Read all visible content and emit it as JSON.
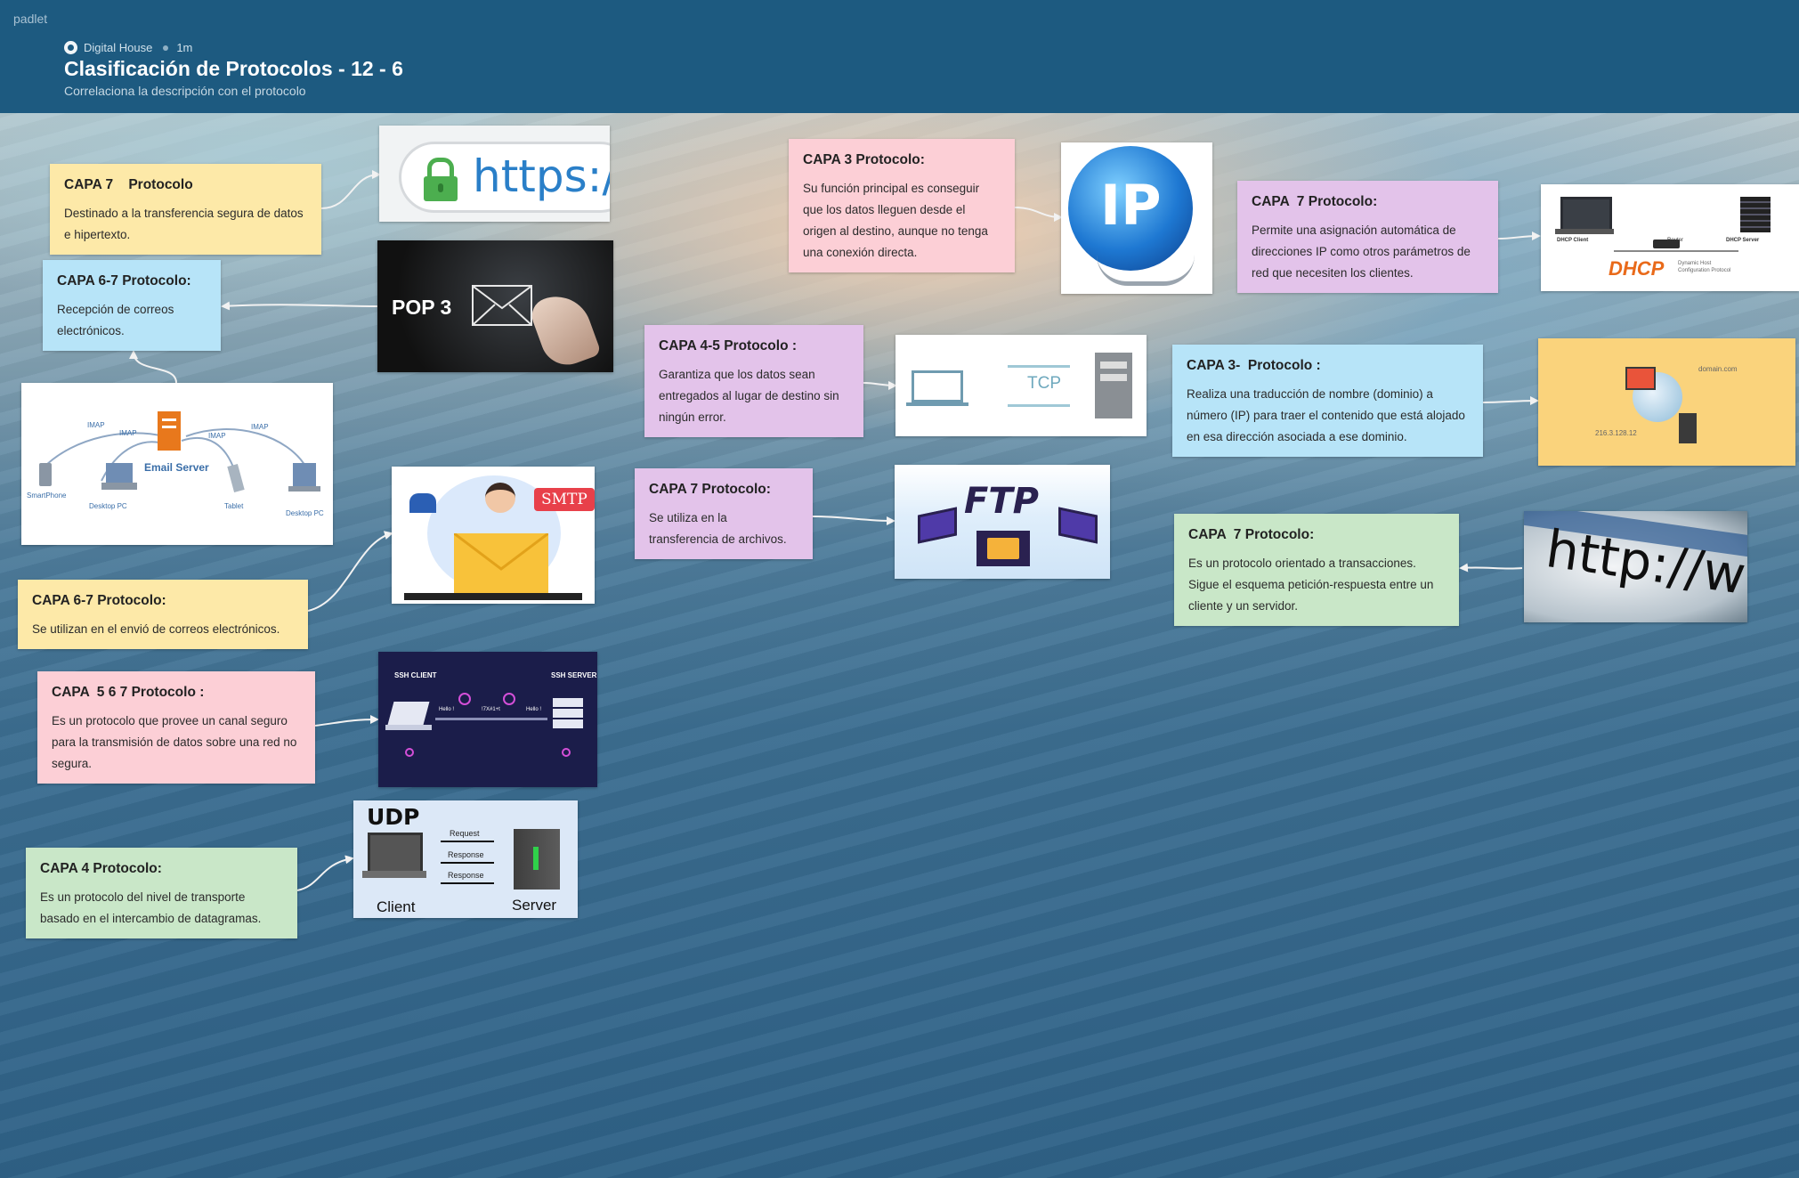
{
  "header": {
    "brand": "padlet",
    "author": "Digital House",
    "time": "1m",
    "title": "Clasificación de Protocolos - 12 - 6",
    "subtitle": "Correlaciona la descripción con el protocolo"
  },
  "cards": [
    {
      "title": "CAPA 7    Protocolo",
      "body": "Destinado a la transferencia segura de datos e hipertexto."
    },
    {
      "title": "CAPA 6-7 Protocolo:",
      "body": "Recepción de correos electrónicos."
    },
    {
      "title": "CAPA 6-7 Protocolo:",
      "body": "Se utilizan en el envió de correos electrónicos."
    },
    {
      "title": "CAPA  5 6 7 Protocolo :",
      "body": "Es un protocolo que provee un canal seguro para la transmisión de datos sobre una red no segura."
    },
    {
      "title": "CAPA 4 Protocolo:",
      "body": "Es un protocolo del nivel de transporte basado en el intercambio de datagramas."
    },
    {
      "title": "CAPA 3 Protocolo:",
      "body": "Su función principal es conseguir que los datos lleguen desde el origen al destino, aunque no tenga una conexión directa."
    },
    {
      "title": "CAPA 4-5 Protocolo :",
      "body": "Garantiza que los datos sean entregados al lugar de destino sin ningún error."
    },
    {
      "title": "CAPA 7 Protocolo:",
      "body": "Se utiliza en la transferencia de archivos."
    },
    {
      "title": "CAPA  7 Protocolo:",
      "body": "Permite una asignación automática de direcciones IP como otros parámetros de red que necesiten los clientes."
    },
    {
      "title": "CAPA 3-  Protocolo :",
      "body": "Realiza una traducción de nombre (dominio) a número (IP) para traer el contenido que está alojado en esa dirección asociada a ese dominio."
    },
    {
      "title": "CAPA  7 Protocolo:",
      "body": "Es un protocolo orientado a transacciones. Sigue el esquema petición-respuesta entre un cliente y un servidor."
    }
  ],
  "images": {
    "https": {
      "text": "https://"
    },
    "pop3": {
      "text": "POP 3"
    },
    "email": {
      "server": "Email Server",
      "imap": "IMAP",
      "smartphone": "SmartPhone",
      "desktop": "Desktop PC",
      "tablet": "Tablet"
    },
    "smtp": {
      "text": "SMTP"
    },
    "ssh": {
      "client": "SSH CLIENT",
      "server": "SSH SERVER",
      "hello1": "Hello !",
      "hello2": "Hello !",
      "cipher": "!7X#1+t"
    },
    "udp": {
      "title": "UDP",
      "request": "Request",
      "response1": "Response",
      "response2": "Response",
      "client": "Client",
      "server": "Server"
    },
    "ip": {
      "text": "IP"
    },
    "tcp": {
      "text": "TCP"
    },
    "ftp": {
      "text": "FTP"
    },
    "dhcp": {
      "client": "DHCP Client",
      "router": "Router",
      "server": "DHCP Server",
      "logo": "DHCP",
      "tagline1": "Dynamic Host",
      "tagline2": "Configuration Protocol"
    },
    "dns": {
      "domain": "domain.com",
      "ip": "216.3.128.12"
    },
    "http": {
      "text": "http://www"
    }
  },
  "colors": {
    "header": "#1d5a80",
    "yellow": "#fde9a8",
    "blue": "#b7e4f8",
    "pink": "#fccfd6",
    "purple": "#e3c3ea",
    "green": "#c9e7c8"
  }
}
